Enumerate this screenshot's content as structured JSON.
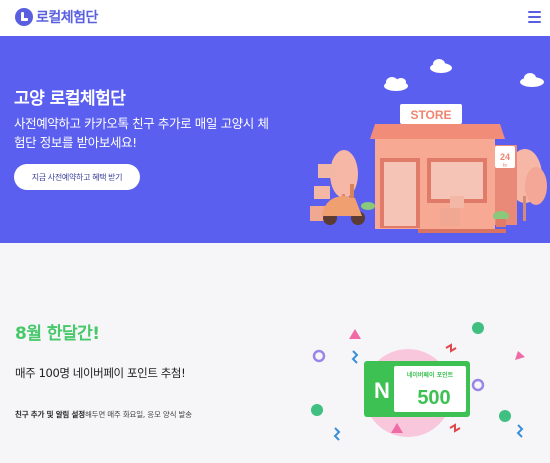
{
  "header": {
    "logo_text": "로컬체험단",
    "menu_icon": "hamburger-menu-icon"
  },
  "hero": {
    "title": "고양 로컬체험단",
    "description": "사전예약하고 카카오톡 친구 추가로 매일 고양시 체험단 정보를 받아보세요!",
    "cta_label": "지금 사전예약하고 혜택 받기",
    "store_sign": "STORE",
    "store_24": "24",
    "store_hr": "hr",
    "background_color": "#5b5ff0"
  },
  "promo": {
    "heading": "8월 한달간!",
    "subheading": "매주 100명 네이버페이 포인트 추첨!",
    "note_bold": "친구 추가 및 알림 설정",
    "note_rest": "해두면 매주 화요일, 응모 양식 발송",
    "card_letter": "N",
    "card_title": "네이버페이 포인트",
    "card_amount": "500",
    "accent_color": "#47c86a"
  }
}
